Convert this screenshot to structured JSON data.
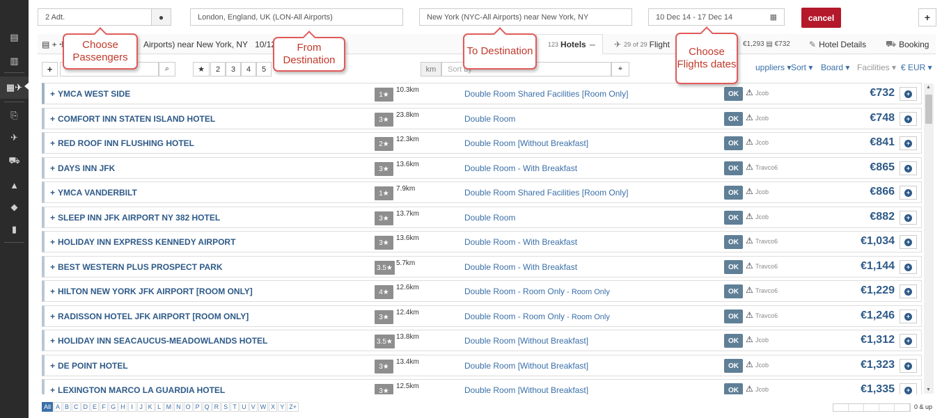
{
  "search": {
    "passengers": "2 Adt.",
    "from": "London, England, UK (LON-All Airports)",
    "to": "New York (NYC-All Airports) near New York, NY",
    "dates": "10 Dec 14 - 17 Dec 14",
    "cancel_label": "cancel",
    "add_label": "+"
  },
  "route": {
    "airports": "Airports) near New York, NY",
    "dates_short": "10/12"
  },
  "tabs": {
    "hotels_count": "123",
    "hotels_label": "Hotels",
    "flights_count": "29",
    "flights_of": "of",
    "flights_total": "29",
    "flights_label": "Flight",
    "price1": "€1,293",
    "price2": "€732",
    "hotel_details": "Hotel Details",
    "booking": "Booking"
  },
  "filters": {
    "plus": "+",
    "star_buttons": [
      "2",
      "3",
      "4",
      "5"
    ],
    "km_label": "km",
    "sort_placeholder": "Sort by",
    "suppliers": "uppliers",
    "sort": "Sort",
    "board": "Board",
    "facilities": "Facilities",
    "currency": "€ EUR"
  },
  "callouts": {
    "passengers": "Choose Passengers",
    "from": "From Destination",
    "to": "To Destination",
    "dates": "Choose Flights dates"
  },
  "hotels": [
    {
      "name": "YMCA WEST SIDE",
      "stars": "1",
      "dist": "10.3km",
      "room": "Double Room Shared Facilities [Room Only]",
      "room_extra": "",
      "status": "OK",
      "supplier": "Jcob",
      "price": "€732"
    },
    {
      "name": "COMFORT INN STATEN ISLAND HOTEL",
      "stars": "3",
      "dist": "23.8km",
      "room": "Double Room",
      "room_extra": "",
      "status": "OK",
      "supplier": "Jcob",
      "price": "€748"
    },
    {
      "name": "RED ROOF INN FLUSHING HOTEL",
      "stars": "2",
      "dist": "12.3km",
      "room": "Double Room [Without Breakfast]",
      "room_extra": "",
      "status": "OK",
      "supplier": "Jcob",
      "price": "€841"
    },
    {
      "name": "DAYS INN JFK",
      "stars": "3",
      "dist": "13.6km",
      "room": "Double Room - With Breakfast",
      "room_extra": "",
      "status": "OK",
      "supplier": "Travco6",
      "price": "€865"
    },
    {
      "name": "YMCA VANDERBILT",
      "stars": "1",
      "dist": "7.9km",
      "room": "Double Room Shared Facilities [Room Only]",
      "room_extra": "",
      "status": "OK",
      "supplier": "Jcob",
      "price": "€866"
    },
    {
      "name": "SLEEP INN JFK AIRPORT NY 382 HOTEL",
      "stars": "3",
      "dist": "13.7km",
      "room": "Double Room",
      "room_extra": "",
      "status": "OK",
      "supplier": "Jcob",
      "price": "€882"
    },
    {
      "name": "HOLIDAY INN EXPRESS KENNEDY AIRPORT",
      "stars": "3",
      "dist": "13.6km",
      "room": "Double Room - With Breakfast",
      "room_extra": "",
      "status": "OK",
      "supplier": "Travco6",
      "price": "€1,034"
    },
    {
      "name": "BEST WESTERN PLUS PROSPECT PARK",
      "stars": "3.5",
      "dist": "5.7km",
      "room": "Double Room - With Breakfast",
      "room_extra": "",
      "status": "OK",
      "supplier": "Travco6",
      "price": "€1,144"
    },
    {
      "name": "HILTON NEW YORK JFK AIRPORT [ROOM ONLY]",
      "stars": "4",
      "dist": "12.6km",
      "room": "Double Room - Room Only",
      "room_extra": " - Room Only",
      "status": "OK",
      "supplier": "Travco6",
      "price": "€1,229"
    },
    {
      "name": "RADISSON HOTEL JFK AIRPORT [ROOM ONLY]",
      "stars": "3",
      "dist": "12.4km",
      "room": "Double Room - Room Only",
      "room_extra": " - Room Only",
      "status": "OK",
      "supplier": "Travco6",
      "price": "€1,246"
    },
    {
      "name": "HOLIDAY INN SEACAUCUS-MEADOWLANDS HOTEL",
      "stars": "3.5",
      "dist": "13.8km",
      "room": "Double Room [Without Breakfast]",
      "room_extra": "",
      "status": "OK",
      "supplier": "Jcob",
      "price": "€1,312"
    },
    {
      "name": "DE POINT HOTEL",
      "stars": "3",
      "dist": "13.4km",
      "room": "Double Room [Without Breakfast]",
      "room_extra": "",
      "status": "OK",
      "supplier": "Jcob",
      "price": "€1,323"
    },
    {
      "name": "LEXINGTON MARCO LA GUARDIA HOTEL",
      "stars": "3",
      "dist": "12.5km",
      "room": "Double Room [Without Breakfast]",
      "room_extra": "",
      "status": "OK",
      "supplier": "Jcob",
      "price": "€1,335"
    }
  ],
  "alphabet": [
    "All",
    "A",
    "B",
    "C",
    "D",
    "E",
    "F",
    "G",
    "H",
    "I",
    "J",
    "K",
    "L",
    "M",
    "N",
    "O",
    "P",
    "Q",
    "R",
    "S",
    "T",
    "U",
    "V",
    "W",
    "X",
    "Y",
    "Z+"
  ],
  "range_label": "0 & up",
  "colors": {
    "accent": "#2e5a88",
    "cancel": "#b4182b",
    "callout": "#e05a5a",
    "ok": "#5f7f96"
  }
}
